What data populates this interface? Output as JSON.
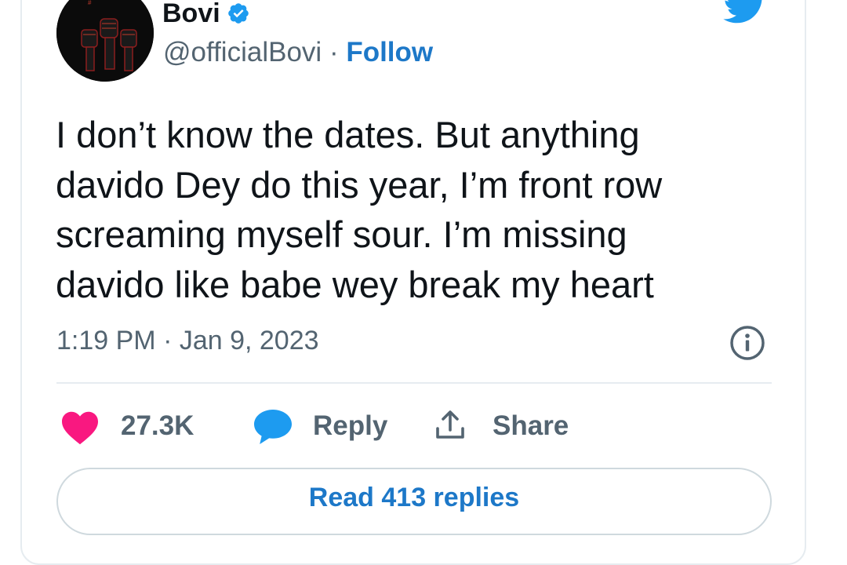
{
  "tweet": {
    "author": {
      "display_name": "Bovi",
      "handle": "@officialBovi",
      "separator": "·",
      "follow_label": "Follow",
      "verified": true,
      "avatar_icon": "raised-fists-avatar"
    },
    "text": "I don’t know the dates. But anything\ndavido Dey do this year, I’m front row\nscreaming myself sour. I’m missing\ndavido like babe wey break my heart",
    "timestamp": "1:19 PM · Jan 9, 2023",
    "actions": {
      "like_count": "27.3K",
      "reply_label": "Reply",
      "share_label": "Share"
    },
    "read_replies_label": "Read 413 replies"
  },
  "colors": {
    "brand_blue": "#1d9bf0",
    "link_blue": "#1d78c8",
    "heart_pink": "#f91880",
    "text_primary": "#0f1419",
    "text_secondary": "#536471"
  },
  "icons": {
    "logo": "twitter-bird-icon",
    "verified": "verified-badge-icon",
    "info": "info-icon",
    "like": "heart-icon",
    "reply": "speech-bubble-icon",
    "share": "share-upload-icon"
  }
}
